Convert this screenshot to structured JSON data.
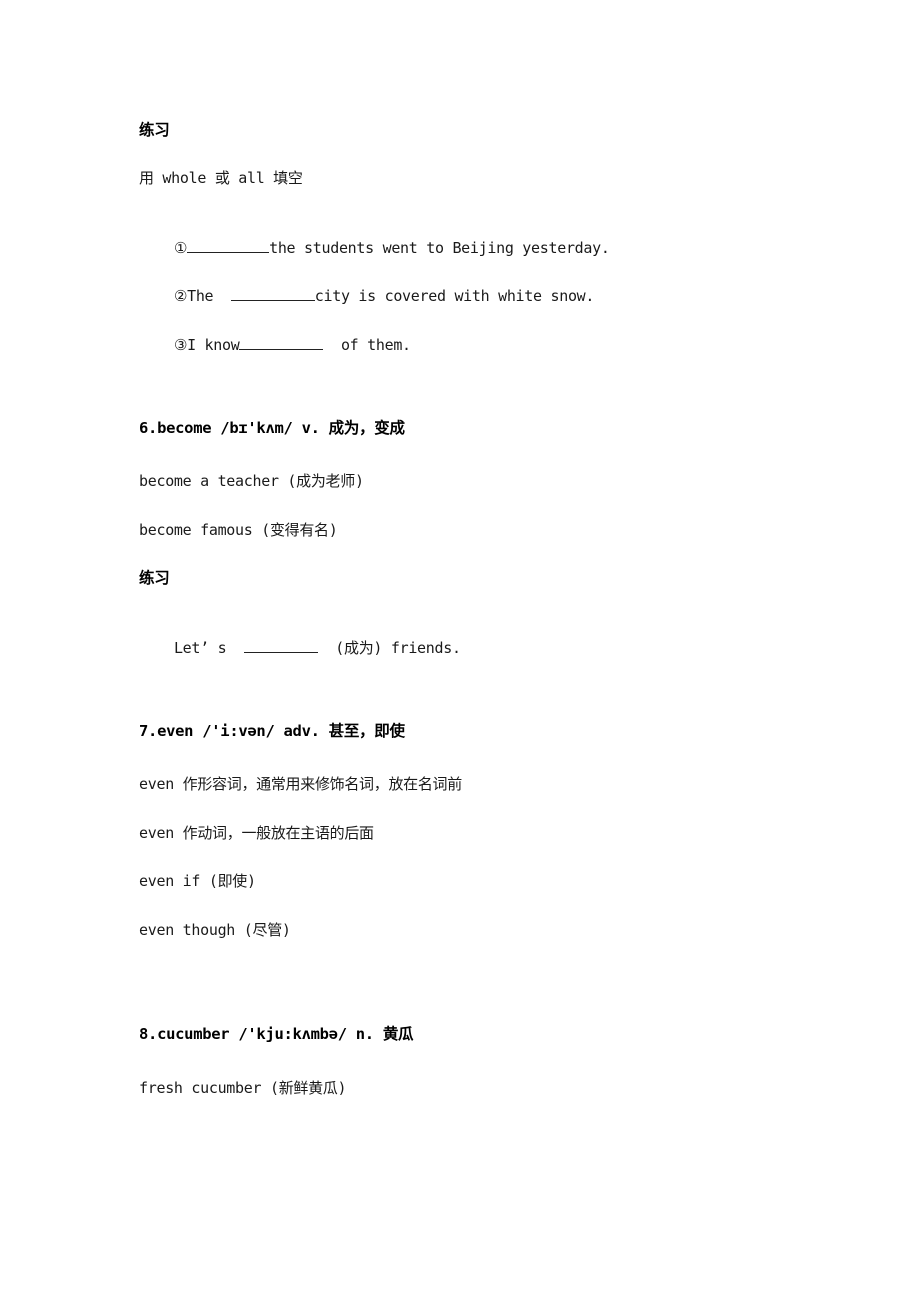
{
  "exercise1": {
    "title": "练习",
    "instruction": "用 whole 或 all 填空",
    "items": [
      {
        "prefix": "①",
        "suffix": "the students went to Beijing yesterday."
      },
      {
        "prefix": "②The  ",
        "suffix": "city is covered with white snow."
      },
      {
        "prefix": "③I know",
        "suffix": "  of them."
      }
    ]
  },
  "entry6": {
    "heading": "6.become /bɪ'kʌm/ v. 成为，变成",
    "examples": [
      "become a teacher (成为老师)",
      "become famous (变得有名)"
    ],
    "exercise_title": "练习",
    "exercise": {
      "prefix": "Let’ s  ",
      "suffix": "  (成为) friends."
    }
  },
  "entry7": {
    "heading": "7.even /'i:vən/ adv. 甚至，即使",
    "notes": [
      "even 作形容词，通常用来修饰名词，放在名词前",
      "even 作动词，一般放在主语的后面",
      "even if (即使)",
      "even though (尽管)"
    ]
  },
  "entry8": {
    "heading": "8.cucumber /'kju:kʌmbə/ n. 黄瓜",
    "examples": [
      "fresh cucumber (新鲜黄瓜)"
    ]
  }
}
